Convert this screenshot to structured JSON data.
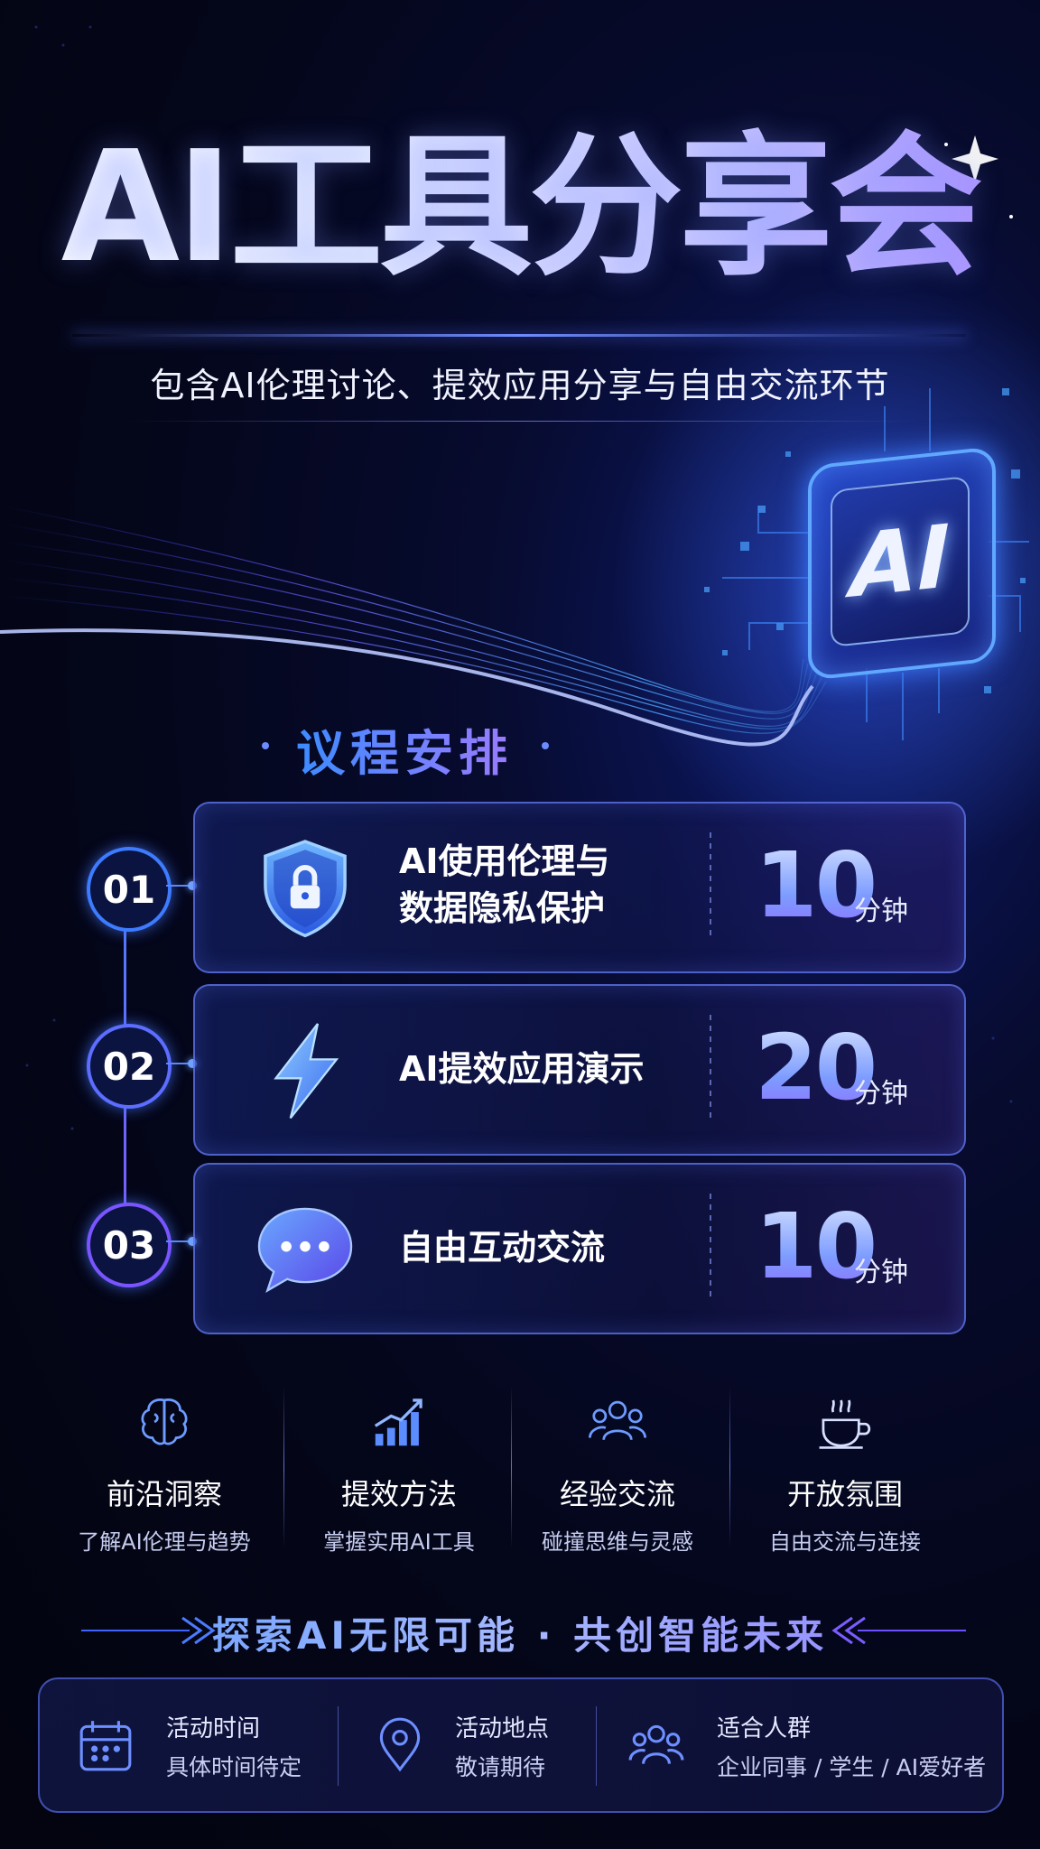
{
  "title": "AI工具分享会",
  "subtitle": "包含AI伦理讨论、提效应用分享与自由交流环节",
  "chip_text": "AI",
  "agenda": {
    "heading": "议程安排",
    "items": [
      {
        "num": "01",
        "title_line1": "AI使用伦理与",
        "title_line2": "数据隐私保护",
        "minutes": "10",
        "unit": "分钟",
        "icon": "shield-lock-icon"
      },
      {
        "num": "02",
        "title_line1": "AI提效应用演示",
        "title_line2": "",
        "minutes": "20",
        "unit": "分钟",
        "icon": "lightning-icon"
      },
      {
        "num": "03",
        "title_line1": "自由互动交流",
        "title_line2": "",
        "minutes": "10",
        "unit": "分钟",
        "icon": "chat-bubble-icon"
      }
    ]
  },
  "features": [
    {
      "title": "前沿洞察",
      "desc": "了解AI伦理与趋势",
      "icon": "brain-icon"
    },
    {
      "title": "提效方法",
      "desc": "掌握实用AI工具",
      "icon": "growth-chart-icon"
    },
    {
      "title": "经验交流",
      "desc": "碰撞思维与灵感",
      "icon": "people-group-icon"
    },
    {
      "title": "开放氛围",
      "desc": "自由交流与连接",
      "icon": "coffee-cup-icon"
    }
  ],
  "slogan": "探索AI无限可能 · 共创智能未来",
  "info": [
    {
      "label": "活动时间",
      "value": "具体时间待定",
      "icon": "calendar-icon"
    },
    {
      "label": "活动地点",
      "value": "敬请期待",
      "icon": "location-pin-icon"
    },
    {
      "label": "适合人群",
      "value": "企业同事 / 学生 / AI爱好者",
      "icon": "people-icon"
    }
  ],
  "colors": {
    "background": "#04061a",
    "accent_blue": "#3d7bff",
    "accent_purple": "#8f6dff",
    "text": "#ffffff"
  }
}
